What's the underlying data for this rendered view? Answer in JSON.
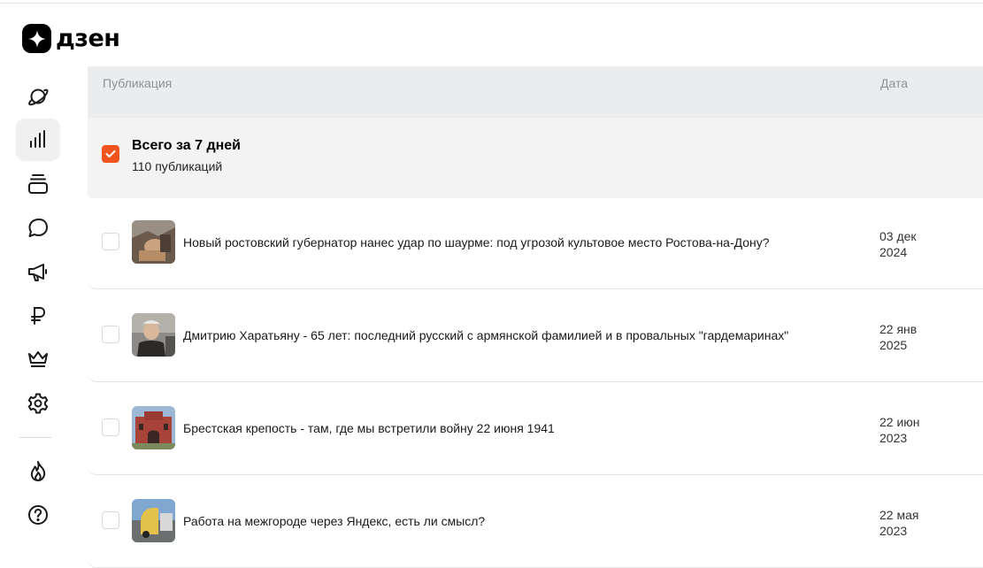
{
  "app": {
    "logo_text": "дзен"
  },
  "sidebar": {
    "items": [
      {
        "icon": "planet-icon",
        "name": "nav-planet",
        "active": false
      },
      {
        "icon": "stats-icon",
        "name": "nav-statistics",
        "active": true
      },
      {
        "icon": "stack-icon",
        "name": "nav-publications",
        "active": false
      },
      {
        "icon": "comment-icon",
        "name": "nav-comments",
        "active": false
      },
      {
        "icon": "megaphone-icon",
        "name": "nav-promotion",
        "active": false
      },
      {
        "icon": "ruble-icon",
        "name": "nav-monetization",
        "active": false
      },
      {
        "icon": "crown-icon",
        "name": "nav-premium",
        "active": false
      },
      {
        "icon": "gear-icon",
        "name": "nav-settings",
        "active": false
      },
      {
        "icon": "flame-icon",
        "name": "nav-trending",
        "active": false
      },
      {
        "icon": "help-icon",
        "name": "nav-help",
        "active": false
      }
    ]
  },
  "table": {
    "headers": {
      "publication": "Публикация",
      "date": "Дата"
    },
    "summary": {
      "title": "Всего за 7 дней",
      "subtitle": "110 публикаций",
      "checked": true
    },
    "rows": [
      {
        "title": "Новый ростовский губернатор нанес удар по шаурме: под угрозой культовое место Ростова-на-Дону?",
        "date_line1": "03 дек",
        "date_line2": "2024",
        "checked": false
      },
      {
        "title": "Дмитрию Харатьяну - 65 лет: последний русский с армянской фамилией и в провальных \"гардемаринах\"",
        "date_line1": "22 янв",
        "date_line2": "2025",
        "checked": false
      },
      {
        "title": "Брестская крепость - там, где мы встретили войну 22 июня 1941",
        "date_line1": "22 июн",
        "date_line2": "2023",
        "checked": false
      },
      {
        "title": "Работа на межгороде через Яндекс, есть ли смысл?",
        "date_line1": "22 мая",
        "date_line2": "2023",
        "checked": false
      }
    ]
  },
  "colors": {
    "accent": "#f2541f",
    "header_bg": "#ebecee",
    "summary_bg": "#f3f3f4"
  }
}
